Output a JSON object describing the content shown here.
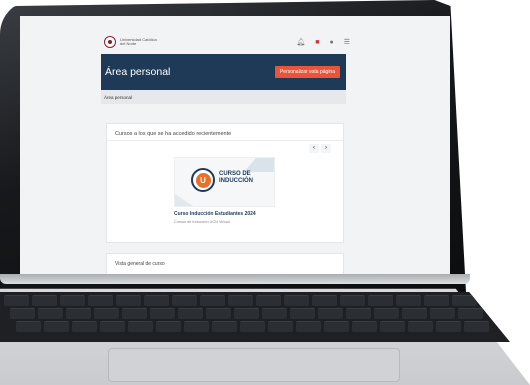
{
  "brand": {
    "name": "Universidad Católica del Norte"
  },
  "header": {
    "title": "Área personal",
    "customize_label": "Personalizar esta página"
  },
  "breadcrumb": {
    "current": "Área personal"
  },
  "recent": {
    "title": "Cursos a los que se ha accedido recientemente",
    "prev": "‹",
    "next": "›",
    "course": {
      "badge_line1": "CURSO DE",
      "badge_line2": "INDUCCIÓN",
      "emblem_letter": "U",
      "name": "Curso Inducción Estudiantes 2024",
      "category": "Cursos de Inducción UCN Virtual"
    }
  },
  "overview": {
    "title": "Vista general de curso"
  },
  "icons": [
    "bell-icon",
    "notification-badge-icon",
    "user-icon",
    "menu-icon"
  ],
  "colors": {
    "header": "#1f3a57",
    "accent": "#e9553a",
    "emblem": "#e9702a"
  }
}
